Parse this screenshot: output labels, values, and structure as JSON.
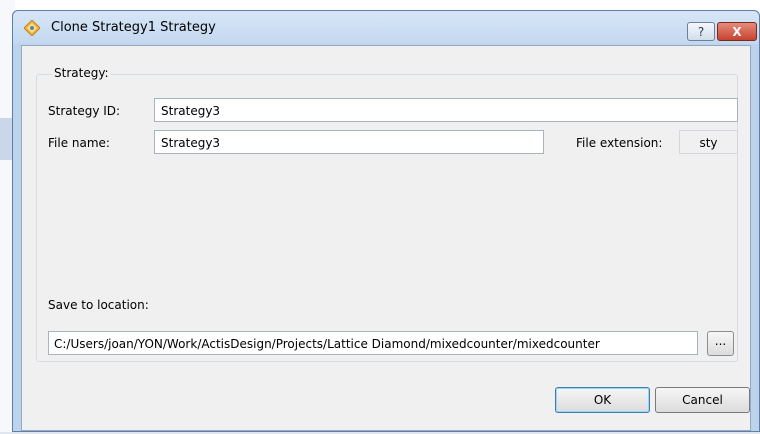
{
  "window": {
    "title": "Clone Strategy1 Strategy",
    "help_glyph": "?",
    "close_glyph": "X"
  },
  "group": {
    "title": "Strategy:"
  },
  "strategy_id": {
    "label": "Strategy ID:",
    "value": "Strategy3"
  },
  "file_name": {
    "label": "File name:",
    "value": "Strategy3"
  },
  "file_extension": {
    "label": "File extension:",
    "value": "sty"
  },
  "save_location": {
    "label": "Save to location:",
    "value": "C:/Users/joan/YON/Work/ActisDesign/Projects/Lattice Diamond/mixedcounter/mixedcounter",
    "browse_label": "..."
  },
  "buttons": {
    "ok_label": "OK",
    "cancel_label": "Cancel"
  },
  "colors": {
    "frame": "#bcd3ec",
    "client": "#f0f0f0",
    "ok_border": "#3c7fb1"
  },
  "icons": {
    "title_icon": "diamond-icon"
  }
}
